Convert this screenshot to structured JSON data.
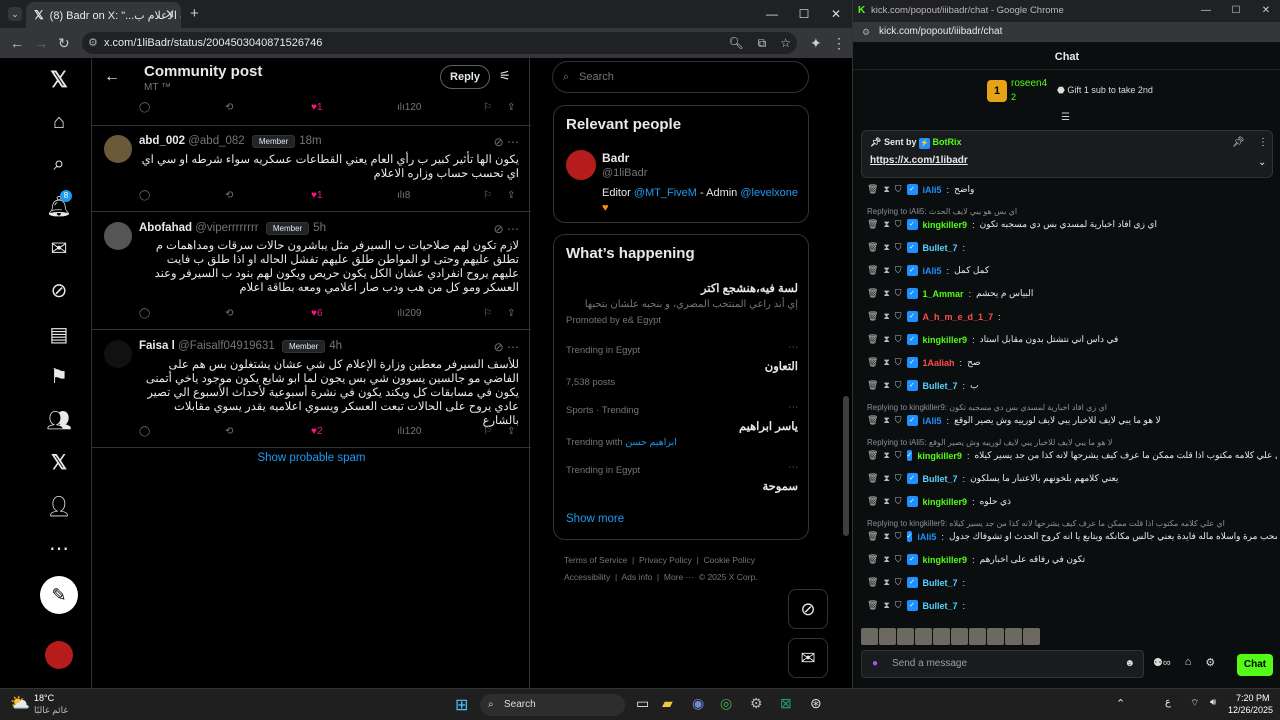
{
  "browser": {
    "tab_title": "(8) Badr on X: \"...ورة الاعلام ب",
    "url": "x.com/1liBadr/status/2004503040871526746"
  },
  "feed": {
    "title": "Community post",
    "subtitle": "MT ™",
    "reply_label": "Reply",
    "spam_label": "Show probable spam",
    "top_actions": {
      "likes": "1",
      "views": "120"
    },
    "posts": [
      {
        "name": "abd_002",
        "handle": "@abd_082",
        "member": "Member",
        "time": "18m",
        "text": "يكون الها تأثير كبير ب رأي العام يعني القطاعات عسكريه سواء شرطه او سي اي اي تحسب حساب وزاره الاعلام",
        "likes": "1",
        "views": "8"
      },
      {
        "name": "Abofahad",
        "handle": "@viperrrrrrrr",
        "member": "Member",
        "time": "5h",
        "text": "لازم تكون لهم صلاحيات ب السيرفر مثل يباشرون حالات سرقات ومداهمات م تطلق عليهم وحتى لو المواطن طلق عليهم تفشل الحاله او اذا طلق ب فايت عليهم يروح انفرادي عشان الكل يكون حريص ويكون لهم بنود ب السيرفر وعند العسكر ومو كل من هب ودب صار اعلامي ومعه بطاقة اعلام",
        "likes": "6",
        "views": "209"
      },
      {
        "name": "Faisa l",
        "handle": "@Faisalf04919631",
        "member": "Member",
        "time": "4h",
        "text": "للأسف السيرفر معطين وزارة الإعلام كل شي عشان يشتغلون بس هم على الفاضي مو جالسين يسوون شي بس يجون لما ابو شايع يكون موجود ياخي أتمنى يكون في مسابقات كل ويكند يكون في نشرة أسبوعية لأحداث الأسبوع الي تصير عادي يروح على الحالات تبعت العسكر ويسوي اعلاميه يقدر يسوي مقابلات بالشارع",
        "likes": "2",
        "views": "120"
      }
    ]
  },
  "right": {
    "search_placeholder": "Search",
    "relevant_title": "Relevant people",
    "person": {
      "name": "Badr",
      "handle": "@1liBadr",
      "bio_prefix": "Editor",
      "bio_link1": "@MT_FiveM",
      "bio_mid": "- Admin",
      "bio_link2": "@levelxone"
    },
    "happening_title": "What’s happening",
    "promo": {
      "title": "لسة فيه،هنشجع اكتر",
      "text": "إي أند راعي المنتخب المصري، و بنحبه علشان بتحبها",
      "promoted": "Promoted by e& Egypt"
    },
    "trends": [
      {
        "meta": "Trending in Egypt",
        "name": "التعاون",
        "posts": "7,538 posts"
      },
      {
        "meta": "Sports · Trending",
        "name": "ياسر ابراهيم",
        "with_label": "Trending with",
        "with_value": "ابراهيم حسن"
      },
      {
        "meta": "Trending in Egypt",
        "name": "سموحة"
      }
    ],
    "show_more": "Show more",
    "footer": [
      "Terms of Service",
      "Privacy Policy",
      "Cookie Policy",
      "Accessibility",
      "Ads info",
      "More ···",
      "© 2025 X Corp."
    ]
  },
  "kick": {
    "window_title": "kick.com/popout/iiibadr/chat - Google Chrome",
    "url": "kick.com/popout/iiibadr/chat",
    "chat_title": "Chat",
    "top_gifter": {
      "name": "roseen4",
      "count": "2",
      "rank": "1",
      "gift_text": "Gift 1 sub to take 2nd"
    },
    "pinned": {
      "sent_by": "Sent by",
      "bot": "BotRix",
      "link": "https://x.com/1libadr"
    },
    "messages": [
      {
        "type": "msg",
        "user": "iAli5",
        "color": "#1e90ff",
        "text": "واضح"
      },
      {
        "type": "reply",
        "text": "Replying to iAli5: اي بس هو يبي لايف الحدث"
      },
      {
        "type": "msg",
        "user": "kingkiller9",
        "color": "#53fc18",
        "text": "اي زي افاد اخبارية لمسدي بس دي مسجبه تكون"
      },
      {
        "type": "msg",
        "user": "Bullet_7",
        "color": "#5ad1ff",
        "text": ""
      },
      {
        "type": "msg",
        "user": "iAli5",
        "color": "#1e90ff",
        "text": "كمل كمل"
      },
      {
        "type": "msg",
        "user": "1_Ammar",
        "color": "#53fc18",
        "text": "البياس م يحشم"
      },
      {
        "type": "msg",
        "user": "A_h_m_e_d_1_7",
        "color": "#ff4d4d",
        "text": ""
      },
      {
        "type": "msg",
        "user": "kingkiller9",
        "color": "#53fc18",
        "text": "في داس اني نتشتل بدون مقابل استاد"
      },
      {
        "type": "msg",
        "user": "1Aaliah",
        "color": "#ff4d4d",
        "text": "صح"
      },
      {
        "type": "msg",
        "user": "Bullet_7",
        "color": "#5ad1ff",
        "text": "ب"
      },
      {
        "type": "reply",
        "text": "Replying to kingkiller9: اي زي افاد اخبارية لمسدي بس دي مسجبه تكون"
      },
      {
        "type": "msg",
        "user": "iAli5",
        "color": "#1e90ff",
        "text": "لا هو ما يبي لايف للاخبار يبي لايف لورييه وش يصير الوقع"
      },
      {
        "type": "reply",
        "text": "Replying to iAli5: لا هو ما يبي لايف للاخبار يبي لايف لورييه وش يصير الوقع"
      },
      {
        "type": "msg",
        "user": "kingkiller9",
        "color": "#53fc18",
        "text": "اي علي كلامه مكتوب اذا قلت ممكن ما عرف كيف يشرحها لانه كذا من جد يسير كيلاه"
      },
      {
        "type": "msg",
        "user": "Bullet_7",
        "color": "#5ad1ff",
        "text": "يعني كلامهم بلخونهم بالاعتبار ما يسلكون"
      },
      {
        "type": "msg",
        "user": "kingkiller9",
        "color": "#53fc18",
        "text": "ذي حلوه"
      },
      {
        "type": "reply",
        "text": "Replying to kingkiller9: اي علي كلامه مكتوب اذا قلت ممكن ما عرف كيف يشرحها لانه كذا من جد يسير كيلاه"
      },
      {
        "type": "msg",
        "user": "iAli5",
        "color": "#1e90ff",
        "text": "اي مسحب مرة واسلاه ماله فايدة يعني جالس مكانكه ويتابع يا انه كروح الحدث او تشوفاك جدول"
      },
      {
        "type": "msg",
        "user": "kingkiller9",
        "color": "#53fc18",
        "text": "تكون في رفاقه على اخبارهم"
      },
      {
        "type": "msg",
        "user": "Bullet_7",
        "color": "#5ad1ff",
        "text": ""
      },
      {
        "type": "msg",
        "user": "Bullet_7",
        "color": "#5ad1ff",
        "text": ""
      }
    ],
    "send_placeholder": "Send a message",
    "chat_button": "Chat"
  },
  "taskbar": {
    "weather_temp": "18°C",
    "weather_text": "غائم غالبًا",
    "search": "Search",
    "time": "7:20 PM",
    "date": "12/26/2025"
  }
}
